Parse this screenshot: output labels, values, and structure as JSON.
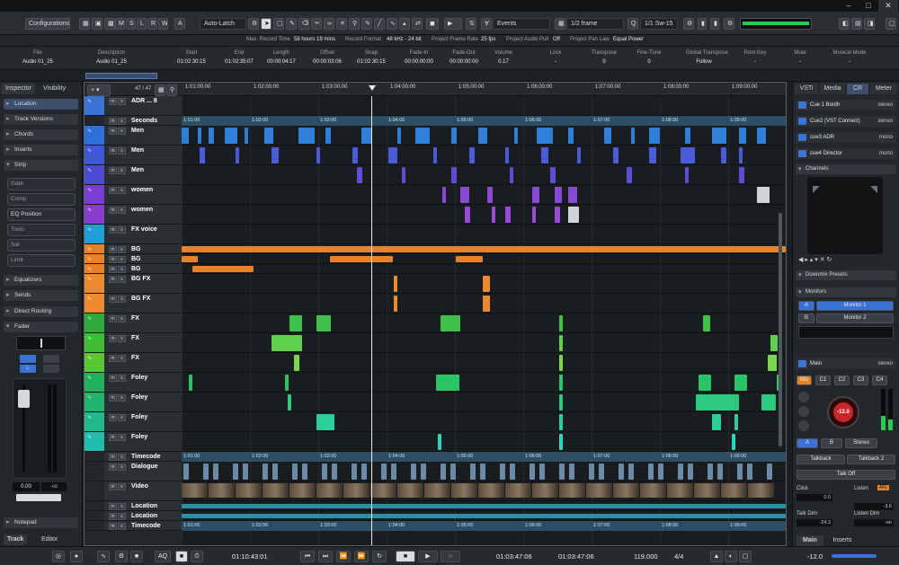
{
  "toolbar": {
    "configurations": "Configurations",
    "modes": [
      "M",
      "S",
      "L",
      "R",
      "W",
      "A"
    ],
    "automation": "Auto-Latch",
    "events_mode": "Events",
    "quantize": "1/2 frame",
    "nudge": "1/1",
    "sw": "Sw-15"
  },
  "status": [
    {
      "label": "Max. Record Time",
      "value": "58 hours 19 mins"
    },
    {
      "label": "Record Format",
      "value": "48 kHz - 24 bit"
    },
    {
      "label": "Project Frame Rate",
      "value": "25 fps"
    },
    {
      "label": "Project Audio Pull",
      "value": "Off"
    },
    {
      "label": "Project Pan Law",
      "value": "Equal Power"
    }
  ],
  "infoline": {
    "headers": [
      "File",
      "Description",
      "Start",
      "End",
      "Length",
      "Offset",
      "Snap",
      "Fade-In",
      "Fade-Out",
      "Volume",
      "Lock",
      "Transpose",
      "Fine-Tune",
      "Global Transpose",
      "Root Key",
      "Mute",
      "Musical Mode"
    ],
    "values": [
      "Audio 01_25",
      "Audio 01_25",
      "01:02:30:15",
      "01:02:35:07",
      "00:00:04:17",
      "00:00:03:06",
      "01:02:30:15",
      "00:00:00:00",
      "00:00:00:00",
      "0.17",
      "-",
      "0",
      "0",
      "Follow",
      "-",
      "-",
      "-"
    ]
  },
  "inspector": {
    "tabs": [
      "Inspector",
      "Visibility"
    ],
    "sections": [
      "Location",
      "Track Versions",
      "Chords",
      "Inserts",
      "Strip"
    ],
    "strip_items": [
      "Gate",
      "Comp",
      "EQ Position",
      "Tools",
      "Sat",
      "Limit"
    ],
    "lower_sections": [
      "Equalizers",
      "Sends",
      "Direct Routing",
      "Fader"
    ],
    "fader_value": "0.00",
    "fader_value2": "-oo",
    "notepad": "Notepad",
    "bottom_tabs": [
      "Track",
      "Editor"
    ]
  },
  "project": {
    "counter": "47 / 47",
    "ruler": [
      "1:01:00:00",
      "1:02:00:00",
      "1:03:00:00",
      "1:04:00:00",
      "1:05:00:00",
      "1:06:00:00",
      "1:07:00:00",
      "1:08:00:00",
      "1:09:00:00"
    ],
    "seconds_ruler": [
      "1:01:00",
      "1:02:00",
      "1:03:00",
      "1:04:00",
      "1:05:00",
      "1:06:00",
      "1:07:00",
      "1:08:00",
      "1:09:00"
    ],
    "tracks": [
      {
        "name": "ADR ... 8",
        "color": "#3a72d6"
      },
      {
        "name": "Seconds",
        "color": "#23272b"
      },
      {
        "name": "Men",
        "color": "#2f6fd8"
      },
      {
        "name": "Men",
        "color": "#3f58d4"
      },
      {
        "name": "Men",
        "color": "#4e4bd3"
      },
      {
        "name": "women",
        "color": "#7a3fd0"
      },
      {
        "name": "women",
        "color": "#8a3ccf"
      },
      {
        "name": "FX voice",
        "color": "#1e9fd8"
      },
      {
        "name": "BG",
        "color": "#e8822a"
      },
      {
        "name": "BG",
        "color": "#e8822a"
      },
      {
        "name": "BG",
        "color": "#e8822a"
      },
      {
        "name": "BG FX",
        "color": "#ee8a2d"
      },
      {
        "name": "BG FX",
        "color": "#ee8a2d"
      },
      {
        "name": "FX",
        "color": "#2faa3d"
      },
      {
        "name": "FX",
        "color": "#3fbb36"
      },
      {
        "name": "FX",
        "color": "#5cc733"
      },
      {
        "name": "Foley",
        "color": "#21b05c"
      },
      {
        "name": "Foley",
        "color": "#22b36e"
      },
      {
        "name": "Foley",
        "color": "#22b88a"
      },
      {
        "name": "Foley",
        "color": "#23bdb0"
      },
      {
        "name": "Timecode",
        "color": "#23272b"
      },
      {
        "name": "Dialogue",
        "color": "#23272b"
      },
      {
        "name": "Video",
        "color": "#23272b"
      },
      {
        "name": "Location",
        "color": "#23272b"
      },
      {
        "name": "Location",
        "color": "#23272b"
      },
      {
        "name": "Timecode",
        "color": "#23272b"
      }
    ]
  },
  "rightzone": {
    "tabs": [
      "VSTi",
      "Media",
      "CR",
      "Meter"
    ],
    "cues": [
      {
        "name": "Cue 1 Booth",
        "mode": "stereo"
      },
      {
        "name": "Cue2 (VST Connect)",
        "mode": "stereo"
      },
      {
        "name": "cue3 ADR",
        "mode": "mono"
      },
      {
        "name": "cue4 Director",
        "mode": "mono"
      }
    ],
    "channels": "Channels",
    "downmix": "Downmix Presets",
    "monitors": "Monitors",
    "monitor_list": [
      {
        "key": "A",
        "name": "Monitor 1"
      },
      {
        "key": "B",
        "name": "Monitor 2"
      }
    ],
    "main": "Main",
    "main_mode": "stereo",
    "mix_buttons": [
      "Mix",
      "C1",
      "C2",
      "C3",
      "C4"
    ],
    "knob_value": "-12.0",
    "abs_buttons": [
      "A",
      "B",
      "Stereo"
    ],
    "talkback": [
      "Talkback",
      "Talkback 2"
    ],
    "talkoff": "Talk Off",
    "click": "Click",
    "listen": "Listen",
    "listen_badge": "AFL",
    "click_value": "0.0",
    "listen_value": "-3.6",
    "talkdim": "Talk Dim",
    "talkdim_value": "-24.3",
    "listendim": "Listen Dim",
    "listendim_value": "-oo",
    "bottom_tabs": [
      "Main",
      "Inserts"
    ]
  },
  "transport": {
    "primary_time": "01:10:43:01",
    "left_locator": "01:03:47:06",
    "right_locator": "01:03:47:06",
    "tempo": "119.000",
    "signature": "4/4",
    "level": "-12.0"
  }
}
